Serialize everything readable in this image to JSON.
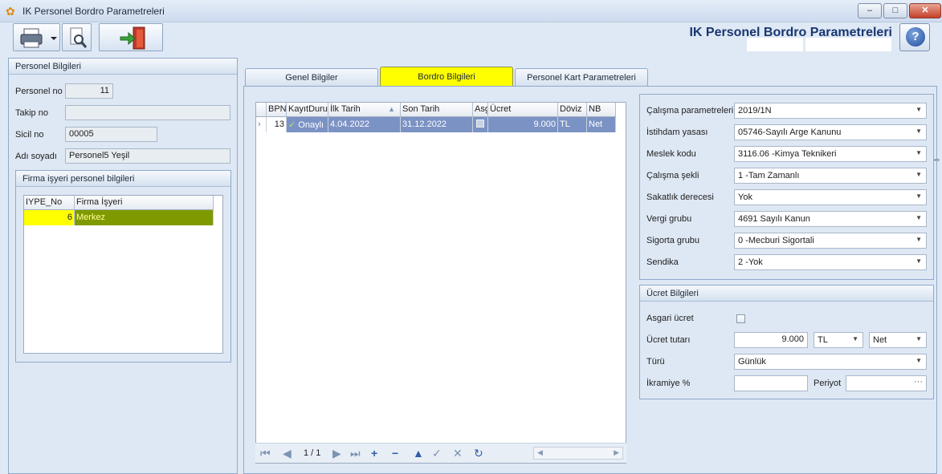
{
  "window": {
    "title": "IK Personel Bordro Parametreleri",
    "minimize": "‒",
    "maximize": "□",
    "close": "✕",
    "app_icon": "butterfly-icon"
  },
  "toolbar": {
    "print_icon": "printer-icon",
    "settings_icon": "wrench-magnifier-icon",
    "exit_icon": "exit-door-icon"
  },
  "header": {
    "title": "IK Personel Bordro Parametreleri",
    "help": "?"
  },
  "personel": {
    "title": "Personel Bilgileri",
    "no_label": "Personel no",
    "no_value": "11",
    "takip_label": "Takip no",
    "takip_value": "",
    "sicil_label": "Sicil no",
    "sicil_value": "00005",
    "adsoyad_label": "Adı soyadı",
    "adsoyad_value": "Personel5 Yeşil",
    "firma_title": "Firma işyeri personel bilgileri",
    "firma_cols": [
      "IYPE_No",
      "Firma İşyeri"
    ],
    "firma_row": {
      "no": "6",
      "isyeri": "Merkez"
    }
  },
  "tabs": [
    "Genel Bilgiler",
    "Bordro Bilgileri",
    "Personel Kart Parametreleri"
  ],
  "bordro_grid": {
    "cols": [
      "BPN",
      "KayıtDurumu",
      "İlk Tarih",
      "Son Tarih",
      "Asgari",
      "Ücret",
      "Döviz",
      "NB"
    ],
    "row": {
      "bpn": "13",
      "durum": "Onaylı",
      "ilk": "4.04.2022",
      "son": "31.12.2022",
      "ucret": "9.000",
      "doviz": "TL",
      "nb": "Net"
    },
    "page": "1 / 1"
  },
  "params": {
    "rows": [
      {
        "label": "Çalışma parametreleri",
        "value": "2019/1N"
      },
      {
        "label": "İstihdam yasası",
        "value": "05746-Sayılı Arge Kanunu"
      },
      {
        "label": "Meslek kodu",
        "value": "3116.06 -Kimya Teknikeri"
      },
      {
        "label": "Çalışma şekli",
        "value": "1 -Tam Zamanlı"
      },
      {
        "label": "Sakatlık derecesi",
        "value": "Yok"
      },
      {
        "label": "Vergi grubu",
        "value": "4691 Sayılı Kanun"
      },
      {
        "label": "Sigorta grubu",
        "value": "0 -Mecburi Sigortali"
      },
      {
        "label": "Sendika",
        "value": "2 -Yok"
      }
    ]
  },
  "ucret": {
    "title": "Ücret Bilgileri",
    "asgari_label": "Asgari ücret",
    "tutar_label": "Ücret tutarı",
    "tutar_value": "9.000",
    "doviz": "TL",
    "nb": "Net",
    "turu_label": "Türü",
    "turu_value": "Günlük",
    "ikramiye_label": "İkramiye %",
    "ikramiye_value": "",
    "periyot_label": "Periyot",
    "periyot_value": "",
    "periyot_btn": "···"
  }
}
